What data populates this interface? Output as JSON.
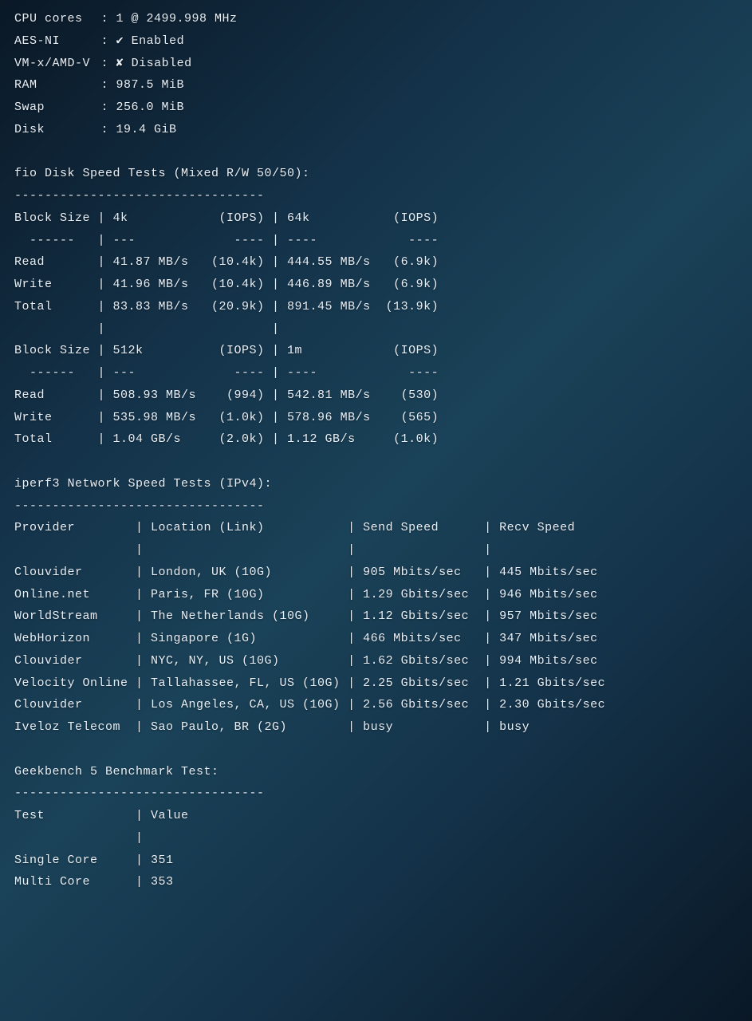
{
  "sys": {
    "cpu_label": "CPU cores",
    "cpu_value": "1 @ 2499.998 MHz",
    "aes_label": "AES-NI",
    "aes_value": "Enabled",
    "aes_icon": "✔",
    "vmx_label": "VM-x/AMD-V",
    "vmx_value": "Disabled",
    "vmx_icon": "✘",
    "ram_label": "RAM",
    "ram_value": "987.5 MiB",
    "swap_label": "Swap",
    "swap_value": "256.0 MiB",
    "disk_label": "Disk",
    "disk_value": "19.4 GiB"
  },
  "fio": {
    "title": "fio Disk Speed Tests (Mixed R/W 50/50):",
    "dashes": "---------------------------------",
    "hdr_block": "Block Size",
    "hdr_iops": "(IOPS)",
    "sub_dashes_left": "  ------",
    "sub_dashes_val": "---",
    "sub_dashes_iops": "----",
    "row_read": "Read",
    "row_write": "Write",
    "row_total": "Total",
    "set1_col1": "4k",
    "set1_col2": "64k",
    "set1_read_v1": "41.87 MB/s",
    "set1_read_i1": "(10.4k)",
    "set1_read_v2": "444.55 MB/s",
    "set1_read_i2": "(6.9k)",
    "set1_write_v1": "41.96 MB/s",
    "set1_write_i1": "(10.4k)",
    "set1_write_v2": "446.89 MB/s",
    "set1_write_i2": "(6.9k)",
    "set1_total_v1": "83.83 MB/s",
    "set1_total_i1": "(20.9k)",
    "set1_total_v2": "891.45 MB/s",
    "set1_total_i2": "(13.9k)",
    "set2_col1": "512k",
    "set2_col2": "1m",
    "set2_read_v1": "508.93 MB/s",
    "set2_read_i1": "(994)",
    "set2_read_v2": "542.81 MB/s",
    "set2_read_i2": "(530)",
    "set2_write_v1": "535.98 MB/s",
    "set2_write_i1": "(1.0k)",
    "set2_write_v2": "578.96 MB/s",
    "set2_write_i2": "(565)",
    "set2_total_v1": "1.04 GB/s",
    "set2_total_i1": "(2.0k)",
    "set2_total_v2": "1.12 GB/s",
    "set2_total_i2": "(1.0k)"
  },
  "iperf": {
    "title": "iperf3 Network Speed Tests (IPv4):",
    "dashes": "---------------------------------",
    "hdr_provider": "Provider",
    "hdr_location": "Location (Link)",
    "hdr_send": "Send Speed",
    "hdr_recv": "Recv Speed",
    "rows": [
      {
        "provider": "Clouvider",
        "location": "London, UK (10G)",
        "send": "905 Mbits/sec",
        "recv": "445 Mbits/sec"
      },
      {
        "provider": "Online.net",
        "location": "Paris, FR (10G)",
        "send": "1.29 Gbits/sec",
        "recv": "946 Mbits/sec"
      },
      {
        "provider": "WorldStream",
        "location": "The Netherlands (10G)",
        "send": "1.12 Gbits/sec",
        "recv": "957 Mbits/sec"
      },
      {
        "provider": "WebHorizon",
        "location": "Singapore (1G)",
        "send": "466 Mbits/sec",
        "recv": "347 Mbits/sec"
      },
      {
        "provider": "Clouvider",
        "location": "NYC, NY, US (10G)",
        "send": "1.62 Gbits/sec",
        "recv": "994 Mbits/sec"
      },
      {
        "provider": "Velocity Online",
        "location": "Tallahassee, FL, US (10G)",
        "send": "2.25 Gbits/sec",
        "recv": "1.21 Gbits/sec"
      },
      {
        "provider": "Clouvider",
        "location": "Los Angeles, CA, US (10G)",
        "send": "2.56 Gbits/sec",
        "recv": "2.30 Gbits/sec"
      },
      {
        "provider": "Iveloz Telecom",
        "location": "Sao Paulo, BR (2G)",
        "send": "busy",
        "recv": "busy"
      }
    ]
  },
  "geekbench": {
    "title": "Geekbench 5 Benchmark Test:",
    "dashes": "---------------------------------",
    "hdr_test": "Test",
    "hdr_value": "Value",
    "single_label": "Single Core",
    "single_value": "351",
    "multi_label": "Multi Core",
    "multi_value": "353"
  }
}
